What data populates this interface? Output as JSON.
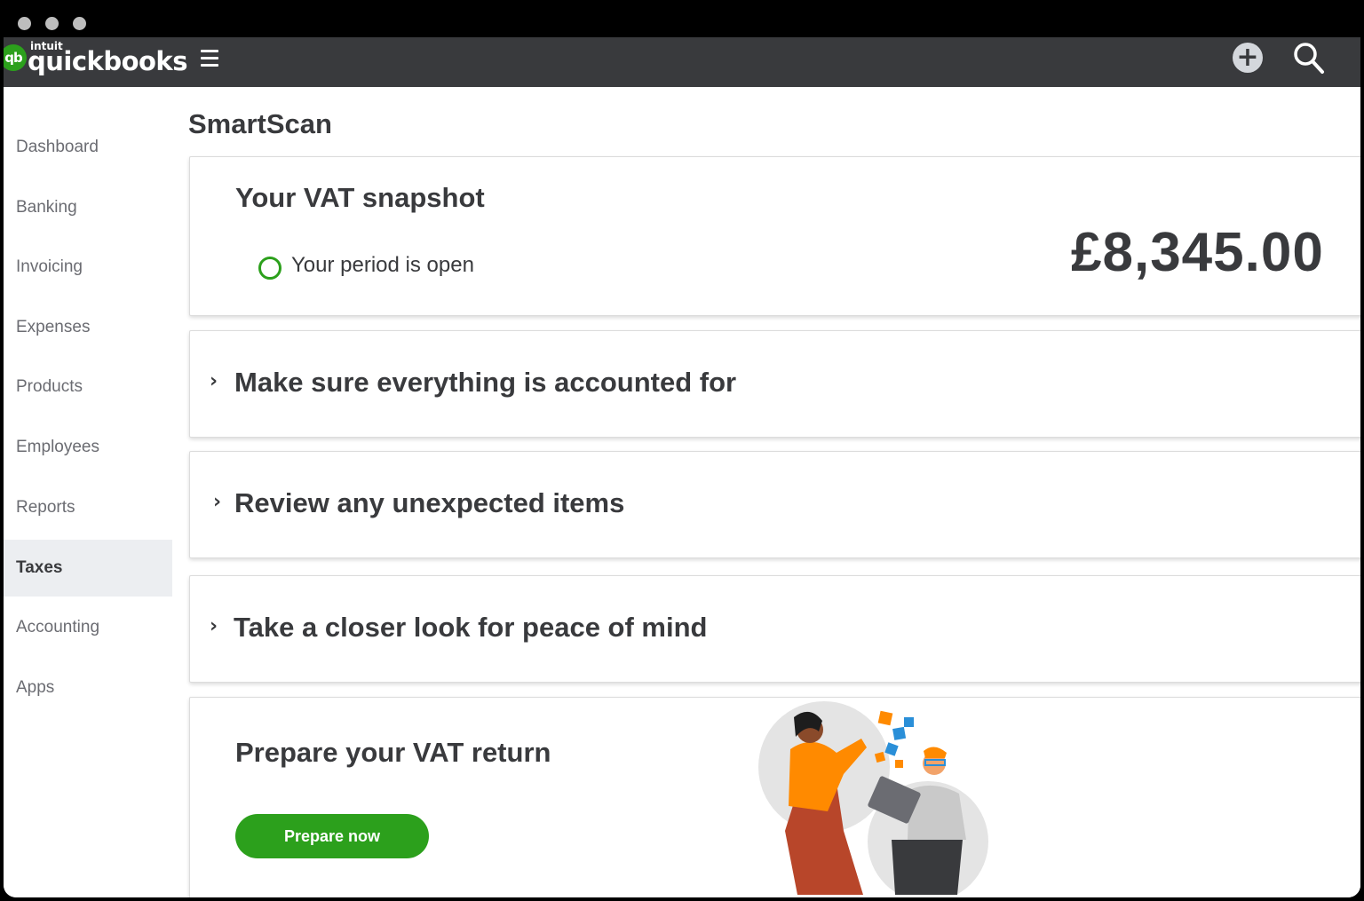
{
  "brand": {
    "company": "intuit",
    "product": "quickbooks",
    "mark": "qb"
  },
  "topbar": {
    "menu_icon": "hamburger-icon",
    "add_icon": "plus-icon",
    "search_icon": "search-icon"
  },
  "sidebar": {
    "items": [
      {
        "label": "Dashboard"
      },
      {
        "label": "Banking"
      },
      {
        "label": "Invoicing"
      },
      {
        "label": "Expenses"
      },
      {
        "label": "Products"
      },
      {
        "label": "Employees"
      },
      {
        "label": "Reports"
      },
      {
        "label": "Taxes",
        "active": true
      },
      {
        "label": "Accounting"
      },
      {
        "label": "Apps"
      }
    ]
  },
  "page": {
    "title": "SmartScan"
  },
  "vat_snapshot": {
    "title": "Your VAT snapshot",
    "status": "Your period is open",
    "amount": "£8,345.00"
  },
  "sections": [
    {
      "title": "Make sure everything is accounted for"
    },
    {
      "title": "Review any unexpected items"
    },
    {
      "title": "Take a closer look for peace of mind"
    }
  ],
  "prepare": {
    "title": "Prepare your VAT return",
    "button": "Prepare now"
  },
  "colors": {
    "brand_green": "#2ca01c",
    "topbar": "#393a3d",
    "accent_orange": "#ff8a00",
    "accent_blue": "#2a8fd8"
  }
}
